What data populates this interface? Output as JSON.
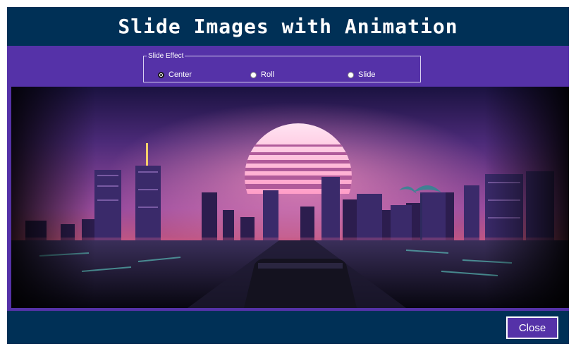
{
  "window": {
    "title": "Slide Images with Animation"
  },
  "slide_effect": {
    "legend": "Slide Effect",
    "options": [
      {
        "label": "Center",
        "checked": true
      },
      {
        "label": "Roll",
        "checked": false
      },
      {
        "label": "Slide",
        "checked": false
      }
    ]
  },
  "footer": {
    "close_label": "Close"
  },
  "colors": {
    "window_bg": "#003056",
    "accent_purple": "#5532a8",
    "text": "#ffffff"
  }
}
